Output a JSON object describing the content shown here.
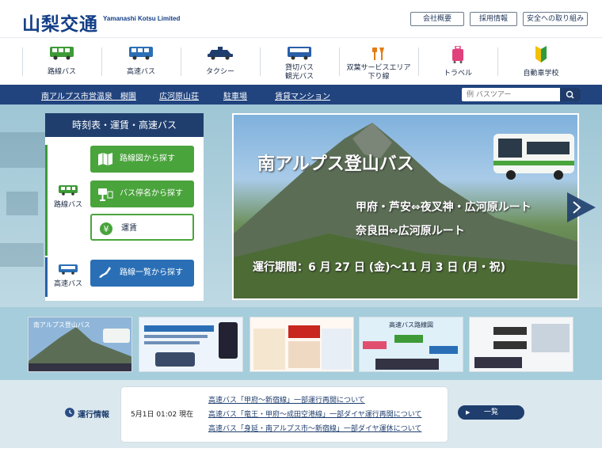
{
  "brand": {
    "logo": "山梨交通",
    "name_en": "Yamanashi Kotsu Limited"
  },
  "top_links": [
    "会社概要",
    "採用情報",
    "安全への取り組み"
  ],
  "categories": [
    {
      "icon": "bus-icon",
      "label": "路線バス"
    },
    {
      "icon": "express-bus-icon",
      "label": "高速バス"
    },
    {
      "icon": "taxi-icon",
      "label": "タクシー"
    },
    {
      "icon": "charter-bus-icon",
      "label": "貸切バス\n観光バス"
    },
    {
      "icon": "service-area-icon",
      "label": "双葉サービスエリア\n下り線"
    },
    {
      "icon": "suitcase-icon",
      "label": "トラベル"
    },
    {
      "icon": "beginner-mark-icon",
      "label": "自動車学校"
    }
  ],
  "strip_links": [
    "南アルプス市営温泉　樹園",
    "広河原山荘",
    "駐車場",
    "賃貸マンション"
  ],
  "search": {
    "placeholder": "例 バスツアー"
  },
  "timetable": {
    "title": "時刻表・運賃・高速バス",
    "route_bus_label": "路線バス",
    "highway_bus_label": "高速バス",
    "buttons": {
      "map_search": "路線図から探す",
      "stop_search": "バス停名から探す",
      "fare": "運賃",
      "route_list": "路線一覧から探す"
    }
  },
  "hero": {
    "title": "南アルプス登山バス",
    "route1": "甲府・芦安⇔夜叉神・広河原ルート",
    "route2": "奈良田⇔広河原ルート",
    "period": "運行期間：6 月 27 日 (金)〜11 月 3 日 (月・祝)"
  },
  "thumbnails": [
    {
      "caption": "南アルプス登山バス"
    },
    {
      "caption": ""
    },
    {
      "caption": ""
    },
    {
      "caption": "高速バス路線図"
    },
    {
      "caption": ""
    }
  ],
  "service_info": {
    "title": "運行情報",
    "timestamp": "5月1日 01:02 現在",
    "items": [
      "高速バス「甲府～新宿線」一部運行再開について",
      "高速バス「竜王・甲府～成田空港線」一部ダイヤ運行再開について",
      "高速バス「身延・南アルプス市～新宿線」一部ダイヤ運休について"
    ],
    "all_label": "一覧"
  },
  "colors": {
    "navy": "#1f3e6e",
    "green": "#4aa43c",
    "blue": "#2a6fb6"
  }
}
